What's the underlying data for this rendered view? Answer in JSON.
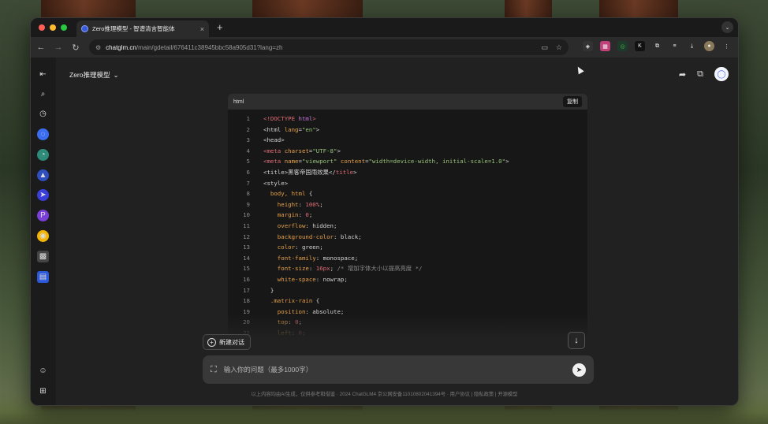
{
  "browser": {
    "tab_title": "Zero推理模型 - 智谱清言智能体",
    "tab_close": "×",
    "new_tab": "+",
    "url_host": "chatglm.cn",
    "url_path": "/main/gdetail/676411c38945bbc58a905d31?lang=zh",
    "traffic_colors": [
      "#ff5f57",
      "#febc2e",
      "#28c840"
    ]
  },
  "header": {
    "model_name": "Zero推理模型",
    "model_chevron": "⌄"
  },
  "code_block": {
    "language": "html",
    "copy_label": "复制",
    "lines": [
      {
        "n": "1",
        "tokens": [
          {
            "t": "<!DOCTYPE ",
            "c": "#e06c75"
          },
          {
            "t": "html",
            "c": "#c678dd"
          },
          {
            "t": ">",
            "c": "#e06c75"
          }
        ]
      },
      {
        "n": "2",
        "tokens": [
          {
            "t": "<html ",
            "c": "#d4d4d4"
          },
          {
            "t": "lang",
            "c": "#e5a14a"
          },
          {
            "t": "=",
            "c": "#d4d4d4"
          },
          {
            "t": "\"en\"",
            "c": "#98c379"
          },
          {
            "t": ">",
            "c": "#d4d4d4"
          }
        ]
      },
      {
        "n": "3",
        "tokens": [
          {
            "t": "<head>",
            "c": "#d4d4d4"
          }
        ]
      },
      {
        "n": "4",
        "tokens": [
          {
            "t": "<meta ",
            "c": "#e06c75"
          },
          {
            "t": "charset",
            "c": "#e5a14a"
          },
          {
            "t": "=",
            "c": "#d4d4d4"
          },
          {
            "t": "\"UTF-8\"",
            "c": "#98c379"
          },
          {
            "t": ">",
            "c": "#d4d4d4"
          }
        ]
      },
      {
        "n": "5",
        "tokens": [
          {
            "t": "<meta ",
            "c": "#e06c75"
          },
          {
            "t": "name",
            "c": "#e5a14a"
          },
          {
            "t": "=",
            "c": "#d4d4d4"
          },
          {
            "t": "\"viewport\" ",
            "c": "#98c379"
          },
          {
            "t": "content",
            "c": "#e5a14a"
          },
          {
            "t": "=",
            "c": "#d4d4d4"
          },
          {
            "t": "\"width=device-width, initial-scale=1.0\"",
            "c": "#98c379"
          },
          {
            "t": ">",
            "c": "#d4d4d4"
          }
        ]
      },
      {
        "n": "6",
        "tokens": [
          {
            "t": "<title>",
            "c": "#d4d4d4"
          },
          {
            "t": "黑客帝国雨效果",
            "c": "#d4d4d4"
          },
          {
            "t": "</",
            "c": "#d4d4d4"
          },
          {
            "t": "title",
            "c": "#e06c75"
          },
          {
            "t": ">",
            "c": "#d4d4d4"
          }
        ]
      },
      {
        "n": "7",
        "tokens": [
          {
            "t": "<style>",
            "c": "#d4d4d4"
          }
        ]
      },
      {
        "n": "8",
        "tokens": [
          {
            "t": "  body, html ",
            "c": "#e5a14a"
          },
          {
            "t": "{",
            "c": "#d4d4d4"
          }
        ]
      },
      {
        "n": "9",
        "tokens": [
          {
            "t": "    height",
            "c": "#e5a14a"
          },
          {
            "t": ": ",
            "c": "#d4d4d4"
          },
          {
            "t": "100%",
            "c": "#e06c75"
          },
          {
            "t": ";",
            "c": "#d4d4d4"
          }
        ]
      },
      {
        "n": "10",
        "tokens": [
          {
            "t": "    margin",
            "c": "#e5a14a"
          },
          {
            "t": ": ",
            "c": "#d4d4d4"
          },
          {
            "t": "0",
            "c": "#e06c75"
          },
          {
            "t": ";",
            "c": "#d4d4d4"
          }
        ]
      },
      {
        "n": "11",
        "tokens": [
          {
            "t": "    overflow",
            "c": "#e5a14a"
          },
          {
            "t": ": hidden;",
            "c": "#d4d4d4"
          }
        ]
      },
      {
        "n": "12",
        "tokens": [
          {
            "t": "    background-color",
            "c": "#e5a14a"
          },
          {
            "t": ": black;",
            "c": "#d4d4d4"
          }
        ]
      },
      {
        "n": "13",
        "tokens": [
          {
            "t": "    color",
            "c": "#e5a14a"
          },
          {
            "t": ": green;",
            "c": "#d4d4d4"
          }
        ]
      },
      {
        "n": "14",
        "tokens": [
          {
            "t": "    font-family",
            "c": "#e5a14a"
          },
          {
            "t": ": monospace;",
            "c": "#d4d4d4"
          }
        ]
      },
      {
        "n": "15",
        "tokens": [
          {
            "t": "    font-size",
            "c": "#e5a14a"
          },
          {
            "t": ": ",
            "c": "#d4d4d4"
          },
          {
            "t": "16px",
            "c": "#e06c75"
          },
          {
            "t": "; ",
            "c": "#d4d4d4"
          },
          {
            "t": "/* 增加字体大小以提高亮度 */",
            "c": "#8a8a8a"
          }
        ]
      },
      {
        "n": "16",
        "tokens": [
          {
            "t": "    white-space",
            "c": "#e5a14a"
          },
          {
            "t": ": nowrap;",
            "c": "#d4d4d4"
          }
        ]
      },
      {
        "n": "17",
        "tokens": [
          {
            "t": "  }",
            "c": "#d4d4d4"
          }
        ]
      },
      {
        "n": "18",
        "tokens": [
          {
            "t": "  .matrix-rain ",
            "c": "#e5a14a"
          },
          {
            "t": "{",
            "c": "#d4d4d4"
          }
        ]
      },
      {
        "n": "19",
        "tokens": [
          {
            "t": "    position",
            "c": "#e5a14a"
          },
          {
            "t": ": absolute;",
            "c": "#d4d4d4"
          }
        ]
      },
      {
        "n": "20",
        "tokens": [
          {
            "t": "    top",
            "c": "#e5a14a"
          },
          {
            "t": ": ",
            "c": "#d4d4d4"
          },
          {
            "t": "0",
            "c": "#e06c75"
          },
          {
            "t": ";",
            "c": "#d4d4d4"
          }
        ]
      },
      {
        "n": "21",
        "tokens": [
          {
            "t": "    left",
            "c": "#e5a14a"
          },
          {
            "t": ": ",
            "c": "#d4d4d4"
          },
          {
            "t": "0",
            "c": "#e06c75"
          },
          {
            "t": ";",
            "c": "#d4d4d4"
          }
        ]
      }
    ]
  },
  "actions": {
    "new_chat": "新建对话",
    "scroll_down": "↓"
  },
  "input": {
    "placeholder": "输入你的问题（最多1000字）"
  },
  "footer": {
    "text": "以上内容均由AI生成，仅供参考和借鉴 · 2024 ChatGLM4 京公网安备11010802041394号 · 用户协议 | 隐私政策 | 开源模型"
  },
  "accent_color": "#4a6cf7"
}
